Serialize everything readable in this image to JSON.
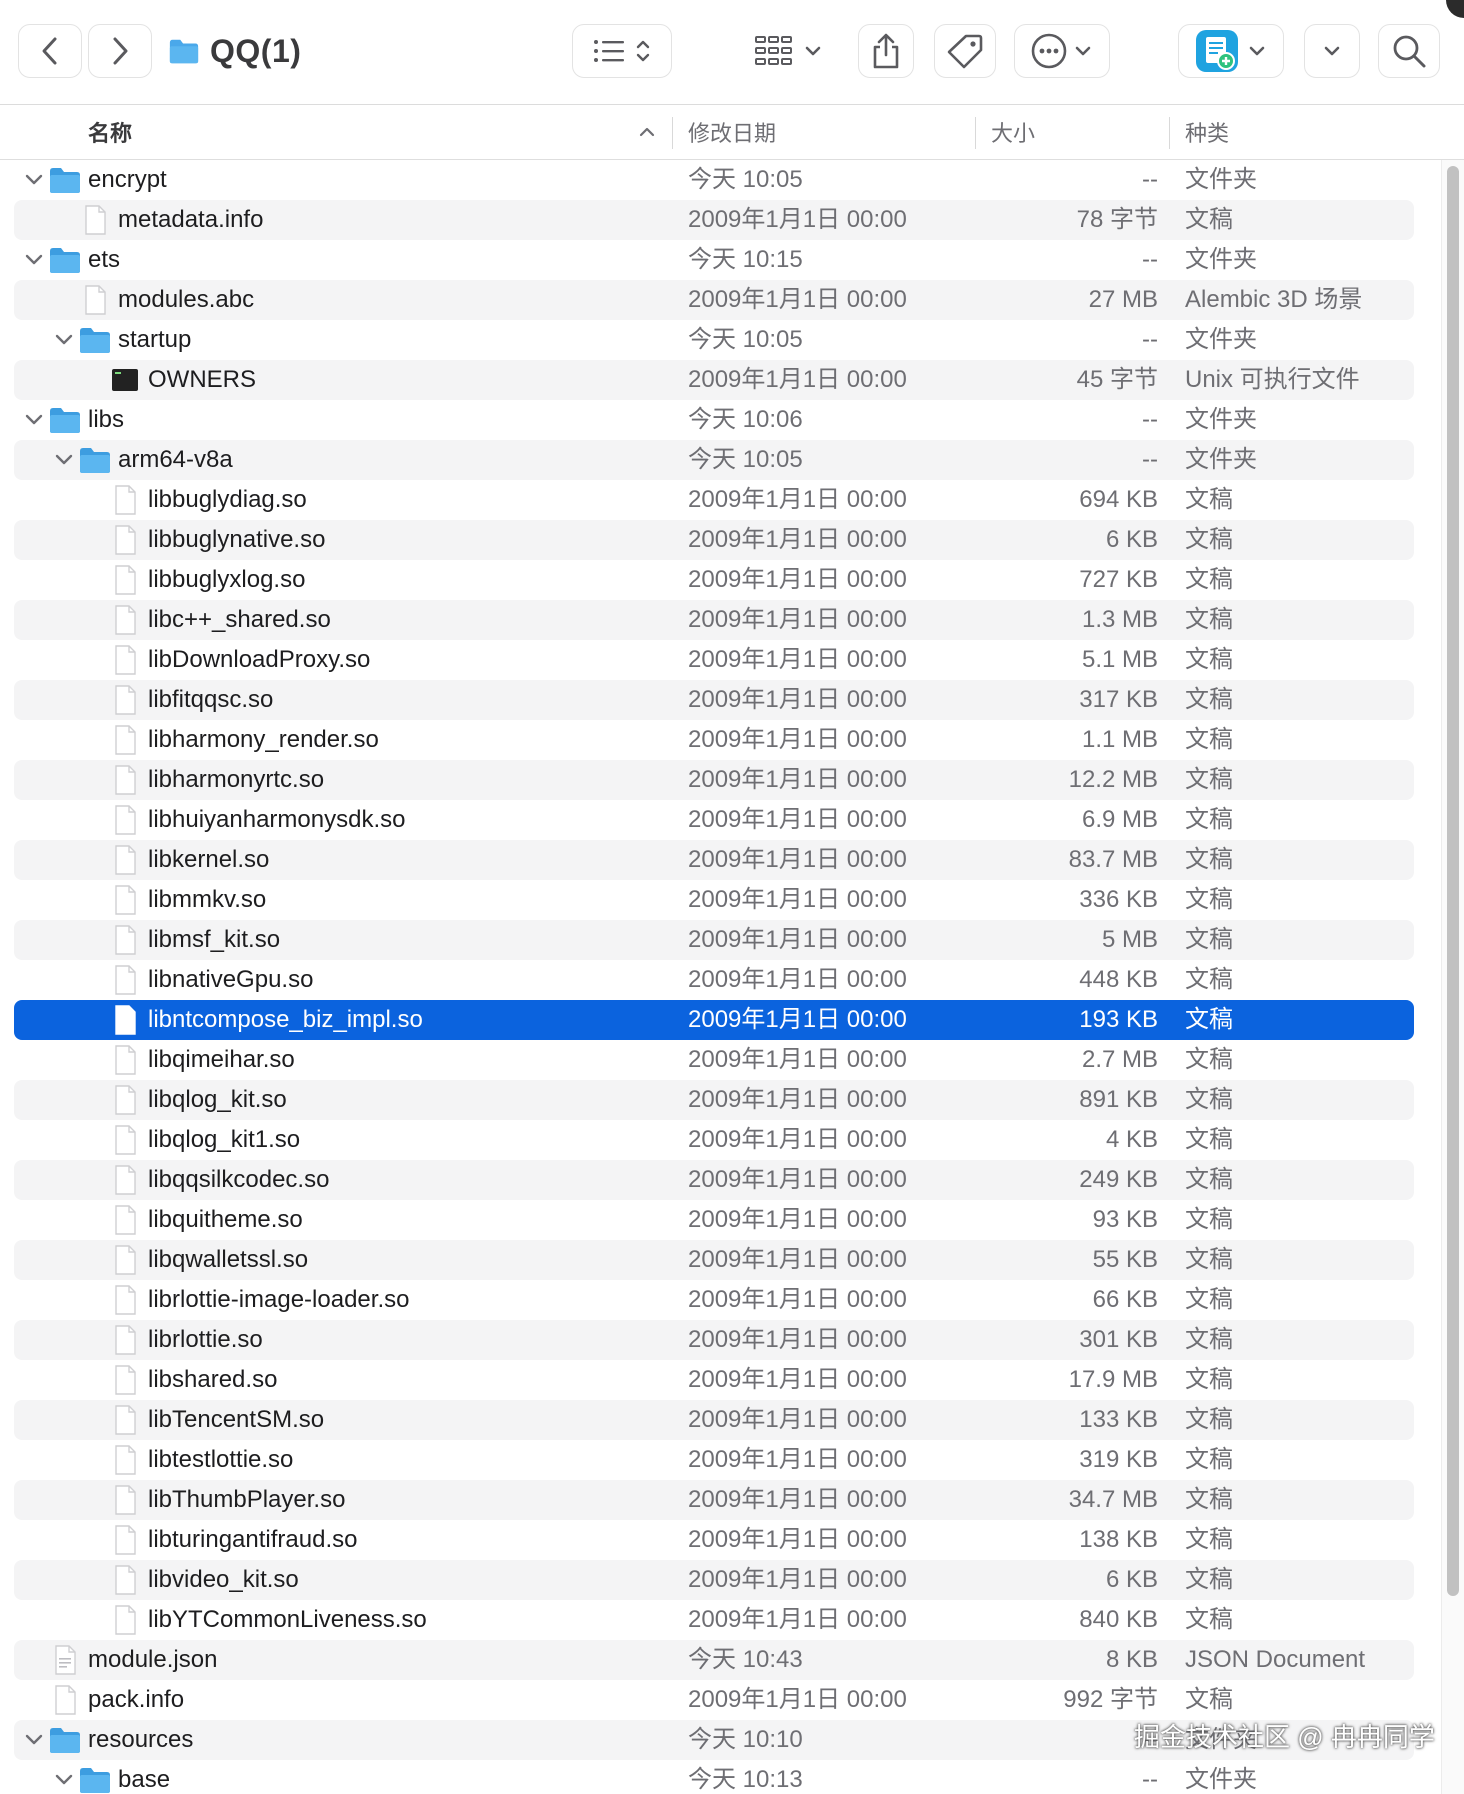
{
  "window": {
    "title": "QQ(1)"
  },
  "columns": {
    "name": "名称",
    "date": "修改日期",
    "size": "大小",
    "kind": "种类"
  },
  "rows": [
    {
      "name": "encrypt",
      "date": "今天 10:05",
      "size": "--",
      "kind": "文件夹",
      "level": 0,
      "type": "folder",
      "expanded": true
    },
    {
      "name": "metadata.info",
      "date": "2009年1月1日 00:00",
      "size": "78 字节",
      "kind": "文稿",
      "level": 1,
      "type": "doc"
    },
    {
      "name": "ets",
      "date": "今天 10:15",
      "size": "--",
      "kind": "文件夹",
      "level": 0,
      "type": "folder",
      "expanded": true
    },
    {
      "name": "modules.abc",
      "date": "2009年1月1日 00:00",
      "size": "27 MB",
      "kind": "Alembic 3D 场景",
      "level": 1,
      "type": "doc"
    },
    {
      "name": "startup",
      "date": "今天 10:05",
      "size": "--",
      "kind": "文件夹",
      "level": 1,
      "type": "folder",
      "expanded": true
    },
    {
      "name": "OWNERS",
      "date": "2009年1月1日 00:00",
      "size": "45 字节",
      "kind": "Unix 可执行文件",
      "level": 2,
      "type": "exec"
    },
    {
      "name": "libs",
      "date": "今天 10:06",
      "size": "--",
      "kind": "文件夹",
      "level": 0,
      "type": "folder",
      "expanded": true
    },
    {
      "name": "arm64-v8a",
      "date": "今天 10:05",
      "size": "--",
      "kind": "文件夹",
      "level": 1,
      "type": "folder",
      "expanded": true
    },
    {
      "name": "libbuglydiag.so",
      "date": "2009年1月1日 00:00",
      "size": "694 KB",
      "kind": "文稿",
      "level": 2,
      "type": "doc"
    },
    {
      "name": "libbuglynative.so",
      "date": "2009年1月1日 00:00",
      "size": "6 KB",
      "kind": "文稿",
      "level": 2,
      "type": "doc"
    },
    {
      "name": "libbuglyxlog.so",
      "date": "2009年1月1日 00:00",
      "size": "727 KB",
      "kind": "文稿",
      "level": 2,
      "type": "doc"
    },
    {
      "name": "libc++_shared.so",
      "date": "2009年1月1日 00:00",
      "size": "1.3 MB",
      "kind": "文稿",
      "level": 2,
      "type": "doc"
    },
    {
      "name": "libDownloadProxy.so",
      "date": "2009年1月1日 00:00",
      "size": "5.1 MB",
      "kind": "文稿",
      "level": 2,
      "type": "doc"
    },
    {
      "name": "libfitqqsc.so",
      "date": "2009年1月1日 00:00",
      "size": "317 KB",
      "kind": "文稿",
      "level": 2,
      "type": "doc"
    },
    {
      "name": "libharmony_render.so",
      "date": "2009年1月1日 00:00",
      "size": "1.1 MB",
      "kind": "文稿",
      "level": 2,
      "type": "doc"
    },
    {
      "name": "libharmonyrtc.so",
      "date": "2009年1月1日 00:00",
      "size": "12.2 MB",
      "kind": "文稿",
      "level": 2,
      "type": "doc"
    },
    {
      "name": "libhuiyanharmonysdk.so",
      "date": "2009年1月1日 00:00",
      "size": "6.9 MB",
      "kind": "文稿",
      "level": 2,
      "type": "doc"
    },
    {
      "name": "libkernel.so",
      "date": "2009年1月1日 00:00",
      "size": "83.7 MB",
      "kind": "文稿",
      "level": 2,
      "type": "doc"
    },
    {
      "name": "libmmkv.so",
      "date": "2009年1月1日 00:00",
      "size": "336 KB",
      "kind": "文稿",
      "level": 2,
      "type": "doc"
    },
    {
      "name": "libmsf_kit.so",
      "date": "2009年1月1日 00:00",
      "size": "5 MB",
      "kind": "文稿",
      "level": 2,
      "type": "doc"
    },
    {
      "name": "libnativeGpu.so",
      "date": "2009年1月1日 00:00",
      "size": "448 KB",
      "kind": "文稿",
      "level": 2,
      "type": "doc"
    },
    {
      "name": "libntcompose_biz_impl.so",
      "date": "2009年1月1日 00:00",
      "size": "193 KB",
      "kind": "文稿",
      "level": 2,
      "type": "doc",
      "selected": true
    },
    {
      "name": "libqimeihar.so",
      "date": "2009年1月1日 00:00",
      "size": "2.7 MB",
      "kind": "文稿",
      "level": 2,
      "type": "doc"
    },
    {
      "name": "libqlog_kit.so",
      "date": "2009年1月1日 00:00",
      "size": "891 KB",
      "kind": "文稿",
      "level": 2,
      "type": "doc"
    },
    {
      "name": "libqlog_kit1.so",
      "date": "2009年1月1日 00:00",
      "size": "4 KB",
      "kind": "文稿",
      "level": 2,
      "type": "doc"
    },
    {
      "name": "libqqsilkcodec.so",
      "date": "2009年1月1日 00:00",
      "size": "249 KB",
      "kind": "文稿",
      "level": 2,
      "type": "doc"
    },
    {
      "name": "libquitheme.so",
      "date": "2009年1月1日 00:00",
      "size": "93 KB",
      "kind": "文稿",
      "level": 2,
      "type": "doc"
    },
    {
      "name": "libqwalletssl.so",
      "date": "2009年1月1日 00:00",
      "size": "55 KB",
      "kind": "文稿",
      "level": 2,
      "type": "doc"
    },
    {
      "name": "librlottie-image-loader.so",
      "date": "2009年1月1日 00:00",
      "size": "66 KB",
      "kind": "文稿",
      "level": 2,
      "type": "doc"
    },
    {
      "name": "librlottie.so",
      "date": "2009年1月1日 00:00",
      "size": "301 KB",
      "kind": "文稿",
      "level": 2,
      "type": "doc"
    },
    {
      "name": "libshared.so",
      "date": "2009年1月1日 00:00",
      "size": "17.9 MB",
      "kind": "文稿",
      "level": 2,
      "type": "doc"
    },
    {
      "name": "libTencentSM.so",
      "date": "2009年1月1日 00:00",
      "size": "133 KB",
      "kind": "文稿",
      "level": 2,
      "type": "doc"
    },
    {
      "name": "libtestlottie.so",
      "date": "2009年1月1日 00:00",
      "size": "319 KB",
      "kind": "文稿",
      "level": 2,
      "type": "doc"
    },
    {
      "name": "libThumbPlayer.so",
      "date": "2009年1月1日 00:00",
      "size": "34.7 MB",
      "kind": "文稿",
      "level": 2,
      "type": "doc"
    },
    {
      "name": "libturingantifraud.so",
      "date": "2009年1月1日 00:00",
      "size": "138 KB",
      "kind": "文稿",
      "level": 2,
      "type": "doc"
    },
    {
      "name": "libvideo_kit.so",
      "date": "2009年1月1日 00:00",
      "size": "6 KB",
      "kind": "文稿",
      "level": 2,
      "type": "doc"
    },
    {
      "name": "libYTCommonLiveness.so",
      "date": "2009年1月1日 00:00",
      "size": "840 KB",
      "kind": "文稿",
      "level": 2,
      "type": "doc"
    },
    {
      "name": "module.json",
      "date": "今天 10:43",
      "size": "8 KB",
      "kind": "JSON Document",
      "level": 0,
      "type": "json"
    },
    {
      "name": "pack.info",
      "date": "2009年1月1日 00:00",
      "size": "992 字节",
      "kind": "文稿",
      "level": 0,
      "type": "doc"
    },
    {
      "name": "resources",
      "date": "今天 10:10",
      "size": "--",
      "kind": "文件夹",
      "level": 0,
      "type": "folder",
      "expanded": true
    },
    {
      "name": "base",
      "date": "今天 10:13",
      "size": "--",
      "kind": "文件夹",
      "level": 1,
      "type": "folder",
      "expanded": true
    }
  ],
  "watermark": "掘金技术社区 @ 冉冉同学",
  "colors": {
    "selection": "#0b63de",
    "folder": "#4aa8ea",
    "stripe": "#f4f4f5",
    "muted_text": "#6e6e73"
  },
  "icons": {
    "back": "chevron-left-icon",
    "forward": "chevron-right-icon",
    "view": "list-view-icon",
    "group": "grid-group-icon",
    "share": "share-icon",
    "tag": "tag-icon",
    "more": "ellipsis-circle-icon",
    "app": "document-app-icon",
    "expand": "chevron-down-icon",
    "search": "search-icon"
  }
}
